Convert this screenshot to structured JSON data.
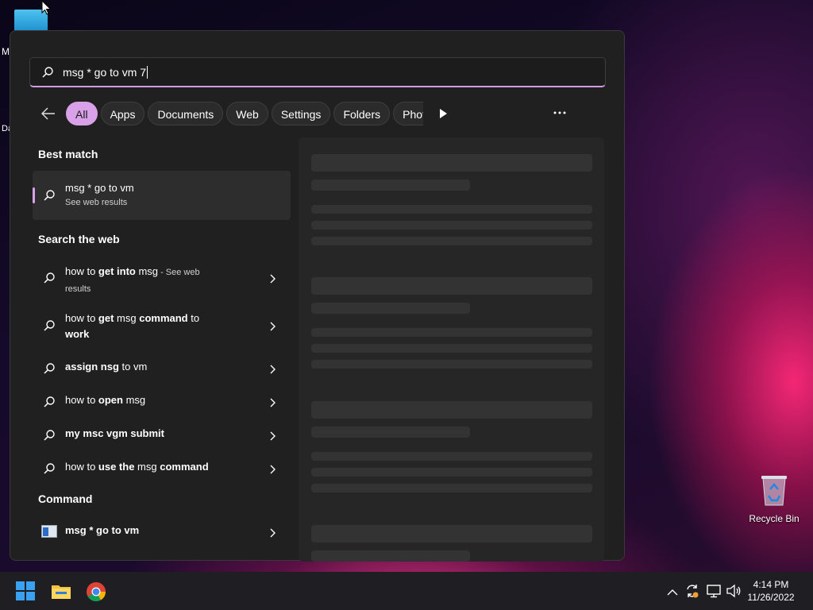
{
  "desktop": {
    "fragment_1": "M",
    "fragment_2": "Da",
    "recycle_bin_label": "Recycle Bin"
  },
  "search": {
    "query": "msg * go to vm 7"
  },
  "filters": {
    "chips": [
      "All",
      "Apps",
      "Documents",
      "Web",
      "Settings",
      "Folders",
      "Phot"
    ],
    "active": "All"
  },
  "best_match": {
    "heading": "Best match",
    "title": "msg * go to vm",
    "subtitle": "See web results"
  },
  "web": {
    "heading": "Search the web",
    "items": [
      {
        "a": "how to ",
        "b": "get into",
        "c": " msg",
        "d": " - See web",
        "e": "results"
      },
      {
        "a": "how to ",
        "b": "get",
        "c": " msg ",
        "d": "command",
        "e": " to",
        "f": "work"
      },
      {
        "a": "",
        "b": "assign",
        "c": " nsg",
        "d": " to vm"
      },
      {
        "a": "how to ",
        "b": "open",
        "c": " msg"
      },
      {
        "a": "my msc vgm submit"
      },
      {
        "a": "how to ",
        "b": "use the",
        "c": " msg ",
        "d": "command"
      }
    ]
  },
  "command": {
    "heading": "Command",
    "title": "msg * go to vm"
  },
  "taskbar": {
    "time": "4:14 PM",
    "date": "11/26/2022"
  },
  "colors": {
    "accent": "#d9a1e8",
    "panel_bg": "#202020",
    "taskbar_bg": "#1f1f23"
  },
  "icons": [
    "search-icon",
    "back-arrow-icon",
    "play-icon",
    "more-icon",
    "chevron-right-icon",
    "command-prompt-icon",
    "windows-start-icon",
    "file-explorer-icon",
    "chrome-icon",
    "chevron-up-icon",
    "sync-icon",
    "network-icon",
    "volume-icon",
    "recycle-bin-icon"
  ]
}
